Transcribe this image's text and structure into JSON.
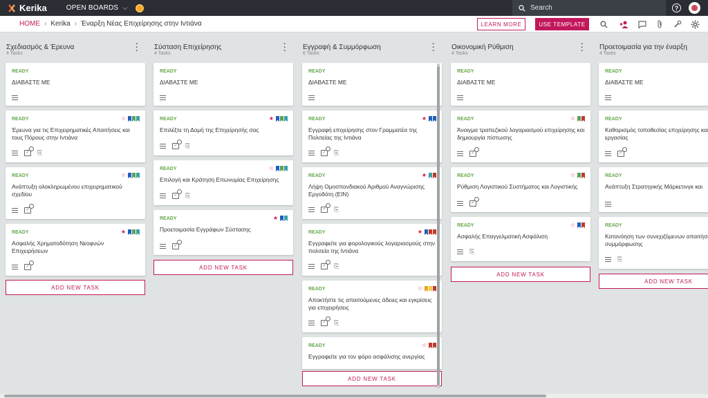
{
  "app": {
    "name": "Kerika",
    "menu_label": "OPEN BOARDS",
    "search_placeholder": "Search"
  },
  "breadcrumb": {
    "home": "HOME",
    "items": [
      "Kerika",
      "Έναρξη Νέας Επιχείρησης στην Ιντιάνα"
    ]
  },
  "toolbar": {
    "learn_more": "LEARN MORE",
    "use_template": "USE TEMPLATE"
  },
  "colors": {
    "accent": "#c2185b",
    "ready": "#66a84c",
    "star": "#d81b3c",
    "blue": "#1f5fbf",
    "green": "#5aa05a",
    "teal": "#3a9fa6",
    "red": "#c0392b",
    "orange": "#f0a020",
    "yellow": "#f2c94c"
  },
  "add_task_label": "ADD NEW TASK",
  "columns": [
    {
      "title": "Σχεδιασμός & Έρευνα",
      "count": "4 Tasks",
      "cards": [
        {
          "status": "READY",
          "title": "ΔΙΑΒΑΣΤΕ ΜΕ"
        },
        {
          "status": "READY",
          "title": "Έρευνα για τις Επιχειρηματικές Απαιτήσεις και τους Πόρους στην Ιντιάνα"
        },
        {
          "status": "READY",
          "title": "Ανάπτυξη ολοκληρωμένου επιχειρηματικού σχεδίου"
        },
        {
          "status": "READY",
          "title": "Ασφαλής Χρηματοδότηση Νεοφυών Επιχειρήσεων"
        }
      ]
    },
    {
      "title": "Σύσταση Επιχείρησης",
      "count": "4 Tasks",
      "cards": [
        {
          "status": "READY",
          "title": "ΔΙΑΒΑΣΤΕ ΜΕ"
        },
        {
          "status": "READY",
          "title": "Επιλέξτε τη Δομή της Επιχείρησής σας"
        },
        {
          "status": "READY",
          "title": "Επιλογή και Κράτηση Επωνυμίας Επιχείρησης"
        },
        {
          "status": "READY",
          "title": "Προετοιμασία Εγγράφων Σύστασης"
        }
      ]
    },
    {
      "title": "Εγγραφή & Συμμόρφωση",
      "count": "6 Tasks",
      "cards": [
        {
          "status": "READY",
          "title": "ΔΙΑΒΑΣΤΕ ΜΕ"
        },
        {
          "status": "READY",
          "title": "Εγγραφή επιχείρησης στον Γραμματέα της Πολιτείας της Ιντιάνα"
        },
        {
          "status": "READY",
          "title": "Λήψη Ομοσπονδιακού Αριθμού Αναγνώρισης Εργοδότη (EIN)"
        },
        {
          "status": "READY",
          "title": "Εγγραφείτε για φορολογικούς λογαριασμούς στην πολιτεία της Ιντιάνα"
        },
        {
          "status": "READY",
          "title": "Αποκτήστε τις απαιτούμενες άδειες και εγκρίσεις για επιχειρήσεις"
        },
        {
          "status": "READY",
          "title": "Εγγραφείτε για τον φόρο ασφάλισης ανεργίας"
        }
      ]
    },
    {
      "title": "Οικονομική Ρύθμιση",
      "count": "4 Tasks",
      "cards": [
        {
          "status": "READY",
          "title": "ΔΙΑΒΑΣΤΕ ΜΕ"
        },
        {
          "status": "READY",
          "title": "Άνοιγμα τραπεζικού λογαριασμού επιχείρησης και δημιουργία πίστωσης"
        },
        {
          "status": "READY",
          "title": "Ρύθμιση Λογιστικού Συστήματος και Λογιστικής"
        },
        {
          "status": "READY",
          "title": "Ασφαλής Επαγγελματική Ασφάλιση"
        }
      ]
    },
    {
      "title": "Προετοιμασία για την έναρξη",
      "count": "4 Tasks",
      "cards": [
        {
          "status": "READY",
          "title": "ΔΙΑΒΑΣΤΕ ΜΕ"
        },
        {
          "status": "READY",
          "title": "Καθορισμός τοποθεσίας επιχείρησης και εργασίας"
        },
        {
          "status": "READY",
          "title": "Ανάπτυξη Στρατηγικής Μάρκετινγκ και"
        },
        {
          "status": "READY",
          "title": "Κατανόηση των συνεχιζόμενων απαιτήσεων συμμόρφωσης"
        }
      ]
    }
  ]
}
